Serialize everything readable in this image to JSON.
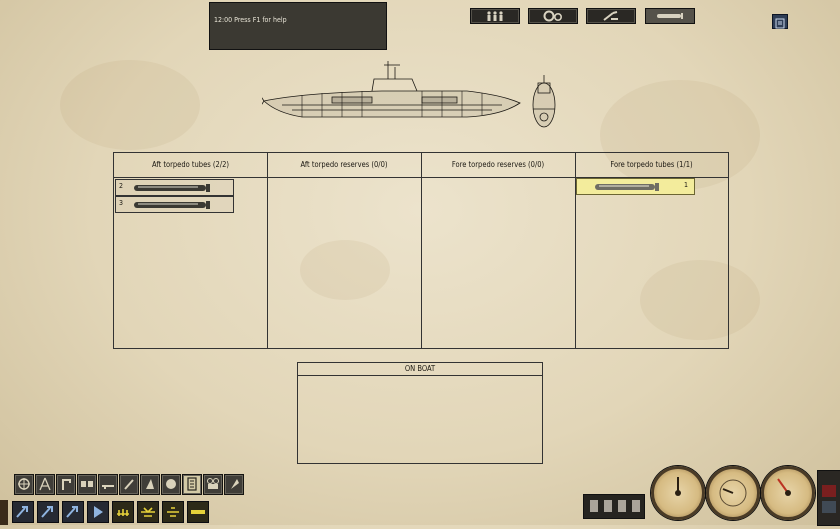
{
  "message_box": {
    "text": "12:00  Press F1 for help"
  },
  "top_buttons": [
    {
      "name": "crew",
      "icon": "crew-icon"
    },
    {
      "name": "systems",
      "icon": "gears-icon"
    },
    {
      "name": "tools",
      "icon": "wrench-icon"
    },
    {
      "name": "torpedoes",
      "icon": "torpedo-icon"
    }
  ],
  "corner_button": {
    "icon": "notepad-icon"
  },
  "torpedo_sections": [
    {
      "title": "Aft torpedo tubes (2/2)",
      "slots": [
        {
          "num": "2"
        },
        {
          "num": "3"
        }
      ]
    },
    {
      "title": "Aft torpedo reserves (0/0)",
      "slots": []
    },
    {
      "title": "Fore torpedo reserves (0/0)",
      "slots": []
    },
    {
      "title": "Fore torpedo tubes (1/1)",
      "slots": [
        {
          "num": "1",
          "selected": true
        }
      ]
    }
  ],
  "on_boat": {
    "title": "ON BOAT"
  },
  "bottom_toolbar": {
    "top_row": [
      "helm-icon",
      "navigator-icon",
      "periscope-icon",
      "uzo-icon",
      "gun-icon",
      "flak-icon",
      "bridge-icon",
      "radio-icon",
      "crew-management-icon",
      "torpedo-management-icon",
      "camera-icon",
      "map-icon"
    ],
    "bottom_row": [
      "crew-orders-1-icon",
      "crew-orders-2-icon",
      "crew-orders-3-icon",
      "depth-icon",
      "menu-1-icon",
      "menu-2-icon",
      "menu-3-icon",
      "menu-4-icon"
    ]
  },
  "gauges": [
    {
      "label": "",
      "label_text": "ahead"
    },
    {
      "label": "",
      "label_text": "depth"
    },
    {
      "label": "",
      "label_text": "speed"
    }
  ],
  "gauge_labels": [
    "STAND",
    "DEPTH",
    "SPEED"
  ],
  "colors": {
    "paper": "#e2d6b8",
    "selected_slot": "#f3ec9c",
    "panel_dark": "#2a2824"
  }
}
